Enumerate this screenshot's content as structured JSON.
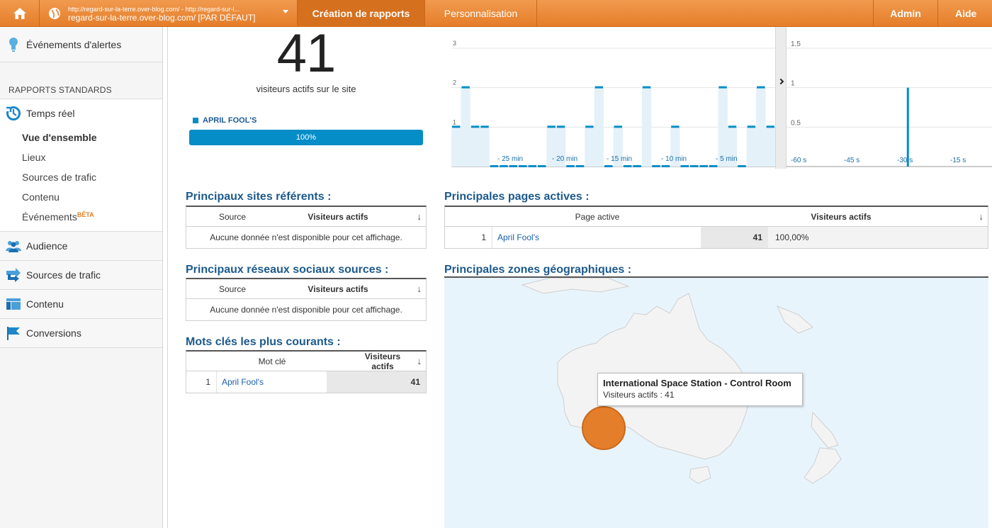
{
  "topbar": {
    "account_url": "http://regard-sur-la-terre.over-blog.com/ - http://regard-sur-l...",
    "account_view": "regard-sur-la-terre.over-blog.com/ [PAR DÉFAUT]",
    "tabs": {
      "reporting": "Création de rapports",
      "custom": "Personnalisation",
      "admin": "Admin",
      "help": "Aide"
    },
    "icons": {
      "home": "home-icon",
      "globe": "globe-icon"
    }
  },
  "sidebar": {
    "alerts": "Événements d'alertes",
    "section": "RAPPORTS STANDARDS",
    "realtime": "Temps réel",
    "realtime_sub": {
      "overview": "Vue d'ensemble",
      "locations": "Lieux",
      "traffic": "Sources de trafic",
      "content": "Contenu",
      "events": "Événements",
      "beta": "BÊTA"
    },
    "audience": "Audience",
    "traffic": "Sources de trafic",
    "content": "Contenu",
    "conversions": "Conversions"
  },
  "summary": {
    "active_count": "41",
    "active_label": "visiteurs actifs sur le site",
    "legend": "APRIL FOOL'S",
    "bar_percent": "100%",
    "bar_fraction": 1.0
  },
  "colors": {
    "accent": "#058dc7",
    "topbar": "#ec8b3c",
    "bubble": "#e57e2a"
  },
  "chart_data": [
    {
      "type": "bar",
      "title": "",
      "x_labels": [
        "- 25 min",
        "- 20 min",
        "- 15 min",
        "- 10 min",
        "- 5 min"
      ],
      "y_ticks": [
        "1",
        "2",
        "3"
      ],
      "ylim": [
        0,
        3
      ],
      "values": [
        1,
        2,
        1,
        1,
        0,
        0,
        0,
        0,
        0,
        0,
        1,
        1,
        0,
        0,
        1,
        2,
        0,
        1,
        0,
        0,
        2,
        0,
        0,
        1,
        0,
        0,
        0,
        0,
        2,
        1,
        0,
        1,
        2,
        1
      ],
      "grid": true
    },
    {
      "type": "bar",
      "title": "",
      "x_labels": [
        "-60 s",
        "-45 s",
        "-30 s",
        "-15 s"
      ],
      "y_ticks": [
        "0.5",
        "1",
        "1.5"
      ],
      "ylim": [
        0,
        1.5
      ],
      "spike_at_seconds": -26,
      "spike_value": 1,
      "grid": true
    }
  ],
  "referrers": {
    "title": "Principaux sites référents :",
    "col_source": "Source",
    "col_visitors": "Visiteurs actifs",
    "empty": "Aucune donnée n'est disponible pour cet affichage."
  },
  "social": {
    "title": "Principaux réseaux sociaux sources :",
    "col_source": "Source",
    "col_visitors": "Visiteurs actifs",
    "empty": "Aucune donnée n'est disponible pour cet affichage."
  },
  "keywords": {
    "title": "Mots clés les plus courants :",
    "col_keyword": "Mot clé",
    "col_visitors": "Visiteurs actifs",
    "rows": [
      {
        "num": "1",
        "keyword": "April Fool's",
        "value": "41"
      }
    ]
  },
  "pages": {
    "title": "Principales pages actives :",
    "col_page": "Page active",
    "col_visitors": "Visiteurs actifs",
    "rows": [
      {
        "num": "1",
        "page": "April Fool's",
        "value": "41",
        "percent": "100,00%"
      }
    ]
  },
  "geo": {
    "title": "Principales zones géographiques :",
    "tooltip_place": "International Space Station - Control Room",
    "tooltip_value": "Visiteurs actifs : 41"
  }
}
